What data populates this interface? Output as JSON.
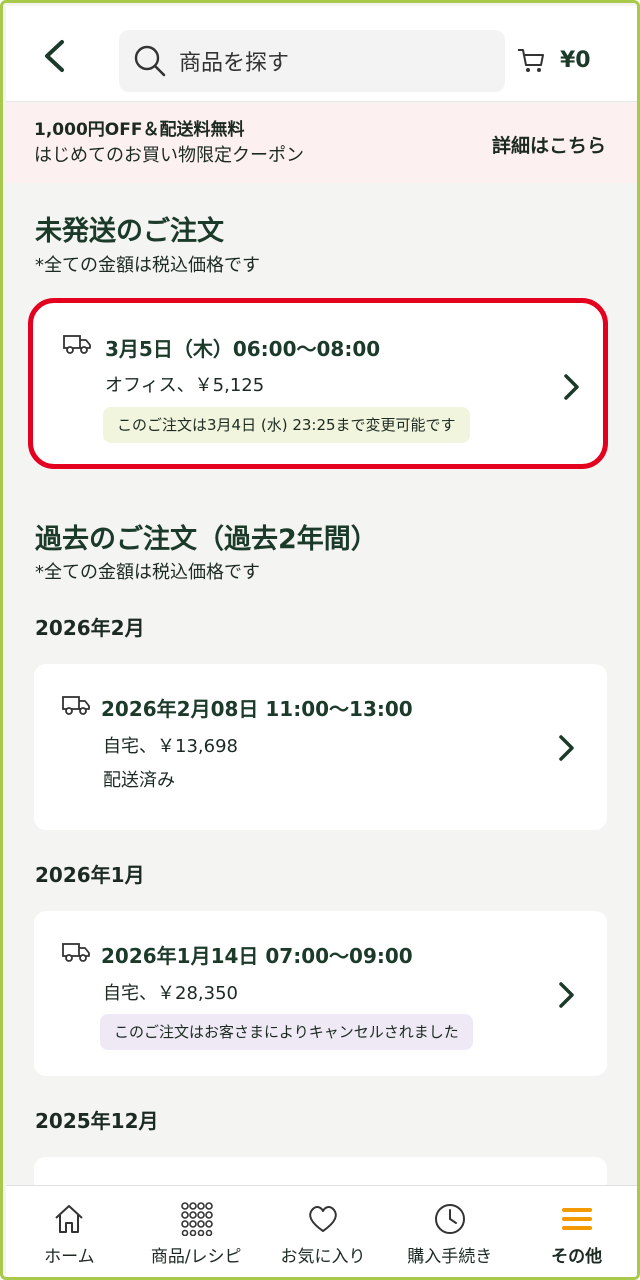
{
  "header": {
    "search_placeholder": "商品を探す",
    "cart_amount": "¥0"
  },
  "promo": {
    "title": "1,000円OFF＆配送料無料",
    "subtitle": "はじめてのお買い物限定クーポン",
    "link": "詳細はこちら"
  },
  "pending": {
    "title": "未発送のご注文",
    "note": "*全ての金額は税込価格です",
    "orders": [
      {
        "date": "3月5日（木）06:00〜08:00",
        "detail": "オフィス、￥5,125",
        "badge": "このご注文は3月4日 (水) 23:25まで変更可能です"
      }
    ]
  },
  "past": {
    "title": "過去のご注文（過去2年間）",
    "note": "*全ての金額は税込価格です",
    "groups": [
      {
        "month": "2026年2月",
        "orders": [
          {
            "date": "2026年2月08日 11:00〜13:00",
            "detail": "自宅、￥13,698",
            "status": "配送済み"
          }
        ]
      },
      {
        "month": "2026年1月",
        "orders": [
          {
            "date": "2026年1月14日 07:00〜09:00",
            "detail": "自宅、￥28,350",
            "badge": "このご注文はお客さまによりキャンセルされました"
          }
        ]
      },
      {
        "month": "2025年12月",
        "orders": []
      }
    ]
  },
  "nav": {
    "items": [
      {
        "label": "ホーム"
      },
      {
        "label": "商品/レシピ"
      },
      {
        "label": "お気に入り"
      },
      {
        "label": "購入手続き"
      },
      {
        "label": "その他"
      }
    ]
  },
  "colors": {
    "brand_dark": "#1c3a2a",
    "highlight_red": "#e4001f",
    "accent_orange": "#f29a00",
    "frame_green": "#a8c94a"
  }
}
